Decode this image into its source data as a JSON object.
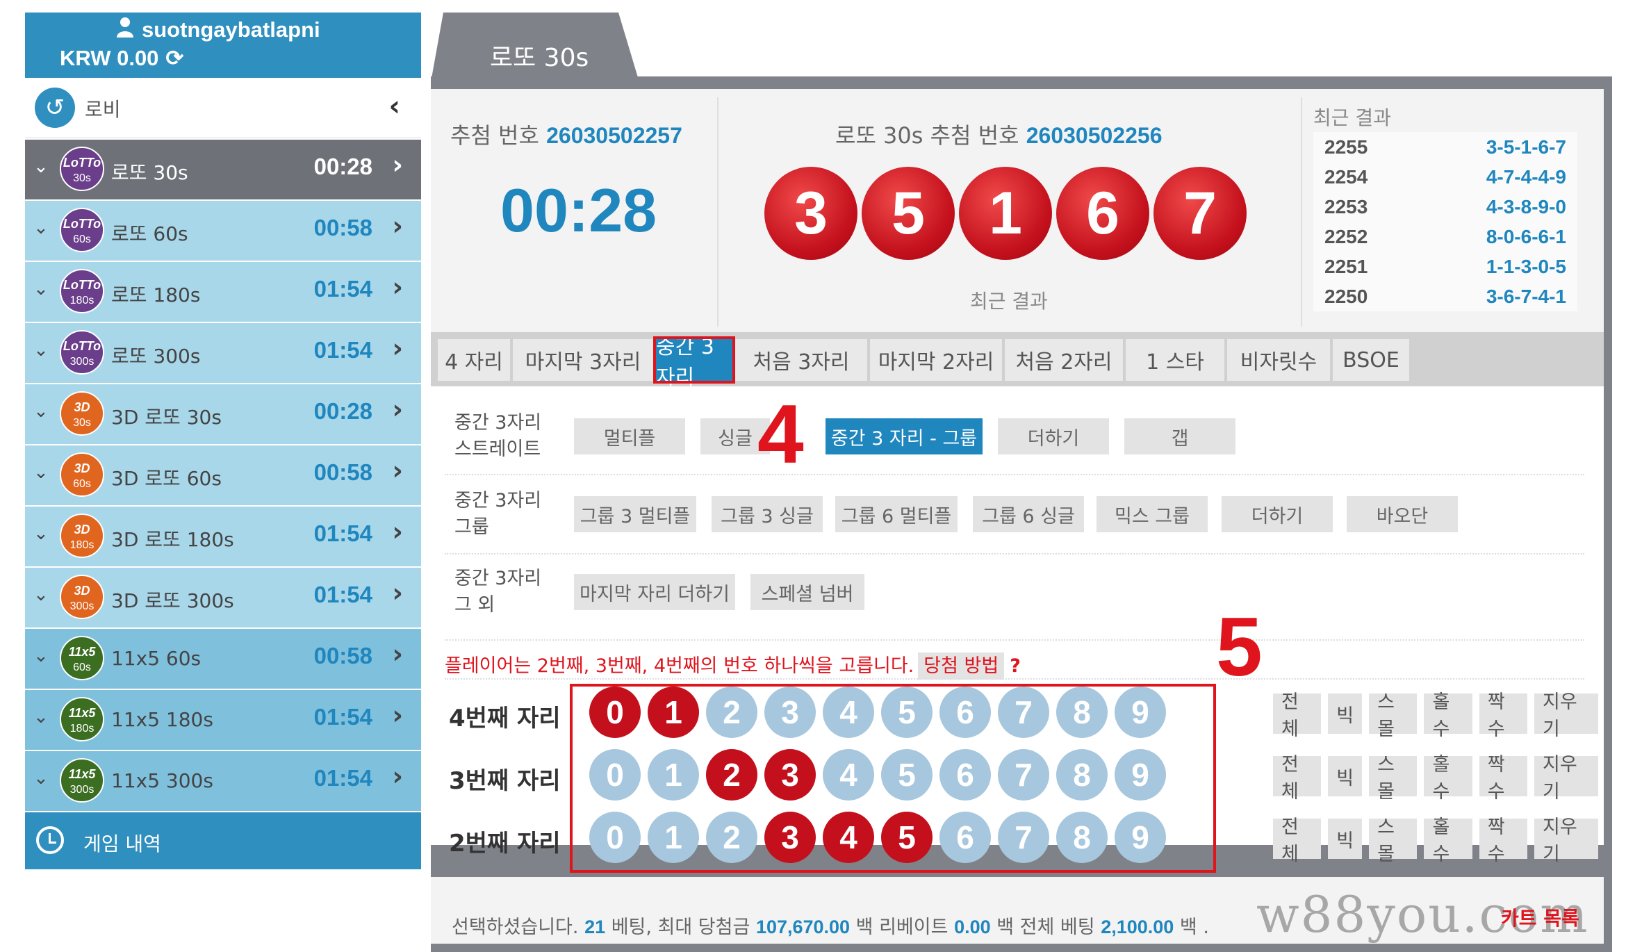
{
  "user": {
    "name": "suotngaybatlapni",
    "balance": "KRW 0.00"
  },
  "lobby": {
    "label": "로비"
  },
  "games": [
    {
      "icon": "lotto",
      "icon_text": "LoTTo",
      "sub": "30s",
      "name": "로또 30s",
      "time": "00:28",
      "active": true
    },
    {
      "icon": "lotto",
      "icon_text": "LoTTo",
      "sub": "60s",
      "name": "로또 60s",
      "time": "00:58"
    },
    {
      "icon": "lotto",
      "icon_text": "LoTTo",
      "sub": "180s",
      "name": "로또 180s",
      "time": "01:54"
    },
    {
      "icon": "lotto",
      "icon_text": "LoTTo",
      "sub": "300s",
      "name": "로또 300s",
      "time": "01:54"
    },
    {
      "icon": "d3",
      "icon_text": "3D",
      "sub": "30s",
      "name": "3D 로또 30s",
      "time": "00:28"
    },
    {
      "icon": "d3",
      "icon_text": "3D",
      "sub": "60s",
      "name": "3D 로또 60s",
      "time": "00:58"
    },
    {
      "icon": "d3",
      "icon_text": "3D",
      "sub": "180s",
      "name": "3D 로또 180s",
      "time": "01:54"
    },
    {
      "icon": "d3",
      "icon_text": "3D",
      "sub": "300s",
      "name": "3D 로또 300s",
      "time": "01:54"
    },
    {
      "icon": "x11",
      "icon_text": "11x5",
      "sub": "60s",
      "name": "11x5 60s",
      "time": "00:58"
    },
    {
      "icon": "x11",
      "icon_text": "11x5",
      "sub": "180s",
      "name": "11x5 180s",
      "time": "01:54"
    },
    {
      "icon": "x11",
      "icon_text": "11x5",
      "sub": "300s",
      "name": "11x5 300s",
      "time": "01:54"
    }
  ],
  "history": {
    "label": "게임 내역"
  },
  "main_tab": "로또 30s",
  "draw": {
    "current_label": "추첨 번호",
    "current_id": "26030502257",
    "countdown": "00:28",
    "prev_label": "로또 30s 추첨 번호",
    "prev_id": "26030502256",
    "balls": [
      "3",
      "5",
      "1",
      "6",
      "7"
    ],
    "under_label": "최근 결과"
  },
  "recent": {
    "title": "최근 결과",
    "rows": [
      {
        "period": "2255",
        "nums": "3-5-1-6-7"
      },
      {
        "period": "2254",
        "nums": "4-7-4-4-9"
      },
      {
        "period": "2253",
        "nums": "4-3-8-9-0"
      },
      {
        "period": "2252",
        "nums": "8-0-6-6-1"
      },
      {
        "period": "2251",
        "nums": "1-1-3-0-5"
      },
      {
        "period": "2250",
        "nums": "3-6-7-4-1"
      }
    ]
  },
  "bet_tabs": [
    "4 자리",
    "마지막 3자리",
    "중간 3자리",
    "처음 3자리",
    "마지막 2자리",
    "처음 2자리",
    "1 스타",
    "비자릿수",
    "BSOE"
  ],
  "selected_tab": "중간 3자리",
  "option_groups": {
    "straight": {
      "label1": "중간 3자리",
      "label2": "스트레이트",
      "opts": [
        "멀티플",
        "싱글",
        "중간 3 자리 - 그룹",
        "더하기",
        "갭"
      ]
    },
    "group": {
      "label1": "중간 3자리",
      "label2": "그룹",
      "opts": [
        "그룹 3 멀티플",
        "그룹 3 싱글",
        "그룹 6 멀티플",
        "그룹 6 싱글",
        "믹스 그룹",
        "더하기",
        "바오단"
      ]
    },
    "other": {
      "label1": "중간 3자리",
      "label2": "그 외",
      "opts": [
        "마지막 자리 더하기",
        "스페셜 넘버"
      ]
    }
  },
  "annotations": {
    "four": "4",
    "five": "5"
  },
  "instruction": {
    "text": "플레이어는 2번째, 3번째, 4번째의 번호 하나씩을 고릅니다.",
    "how": "당첨 방법",
    "q": "?"
  },
  "pick_rows": [
    {
      "label": "4번째 자리",
      "selected": [
        0,
        1
      ]
    },
    {
      "label": "3번째 자리",
      "selected": [
        2,
        3
      ]
    },
    {
      "label": "2번째 자리",
      "selected": [
        3,
        4,
        5
      ]
    }
  ],
  "digits": [
    "0",
    "1",
    "2",
    "3",
    "4",
    "5",
    "6",
    "7",
    "8",
    "9"
  ],
  "quick_buttons": [
    "전체",
    "빅",
    "스몰",
    "홀수",
    "짝수",
    "지우기"
  ],
  "footer": {
    "t1": "선택하셨습니다.",
    "bets": "21",
    "t2": "베팅, 최대 당첨금",
    "max_win": "107,670.00",
    "t3": "백 리베이트",
    "rebate": "0.00",
    "t4": "백 전체 베팅",
    "total": "2,100.00",
    "t5": "백 ."
  },
  "watermark": "w88you.com",
  "cart": "카트 목록",
  "colors": {
    "blue": "#1f86be",
    "red": "#c3101c",
    "sidebar_blue": "#2f8fbf"
  }
}
